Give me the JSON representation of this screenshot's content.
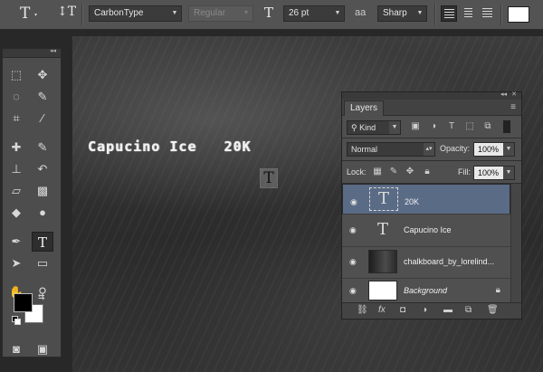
{
  "options_bar": {
    "tool_icon": "T",
    "orient_icon": "↕T",
    "font_family": "CarbonType",
    "font_style": "Regular",
    "size_icon": "T",
    "font_size": "26 pt",
    "aa_icon": "aa",
    "antialias": "Sharp",
    "color_hex": "#ffffff"
  },
  "canvas": {
    "text": "Capucino Ice   20K",
    "cursor_glyph": "T"
  },
  "tools": [
    {
      "name": "marquee-tool-icon",
      "glyph": "⬚"
    },
    {
      "name": "move-tool-icon",
      "glyph": "✥"
    },
    {
      "name": "lasso-tool-icon",
      "glyph": "◌"
    },
    {
      "name": "quick-select-tool-icon",
      "glyph": "✎"
    },
    {
      "name": "crop-tool-icon",
      "glyph": "⌗"
    },
    {
      "name": "eyedropper-tool-icon",
      "glyph": "⁄"
    },
    {
      "name": "healing-tool-icon",
      "glyph": "✚"
    },
    {
      "name": "brush-tool-icon",
      "glyph": "✎"
    },
    {
      "name": "stamp-tool-icon",
      "glyph": "⊥"
    },
    {
      "name": "history-brush-tool-icon",
      "glyph": "↶"
    },
    {
      "name": "eraser-tool-icon",
      "glyph": "▱"
    },
    {
      "name": "gradient-tool-icon",
      "glyph": "▩"
    },
    {
      "name": "blur-tool-icon",
      "glyph": "◆"
    },
    {
      "name": "dodge-tool-icon",
      "glyph": "●"
    },
    {
      "name": "pen-tool-icon",
      "glyph": "✒"
    },
    {
      "name": "type-tool-icon",
      "glyph": "T"
    },
    {
      "name": "path-select-tool-icon",
      "glyph": "➤"
    },
    {
      "name": "shape-tool-icon",
      "glyph": "▭"
    },
    {
      "name": "hand-tool-icon",
      "glyph": "✋"
    },
    {
      "name": "zoom-tool-icon",
      "glyph": "⚲"
    },
    {
      "name": "quick-mask-icon",
      "glyph": "◙"
    },
    {
      "name": "screen-mode-icon",
      "glyph": "▣"
    }
  ],
  "layers_panel": {
    "title": "Layers",
    "filter_kind": "Kind",
    "blend_mode": "Normal",
    "opacity_label": "Opacity:",
    "opacity": "100%",
    "lock_label": "Lock:",
    "fill_label": "Fill:",
    "fill": "100%",
    "layers": [
      {
        "name": "20K",
        "thumb": "T",
        "type": "text",
        "selected": true
      },
      {
        "name": "Capucino Ice",
        "thumb": "T",
        "type": "text",
        "selected": false
      },
      {
        "name": "chalkboard_by_lorelind...",
        "thumb": "",
        "type": "image",
        "selected": false
      },
      {
        "name": "Background",
        "thumb": "",
        "type": "background",
        "selected": false
      }
    ],
    "footer_icons": [
      "link-icon",
      "fx-icon",
      "mask-icon",
      "adjustment-icon",
      "group-icon",
      "new-layer-icon",
      "trash-icon"
    ]
  }
}
